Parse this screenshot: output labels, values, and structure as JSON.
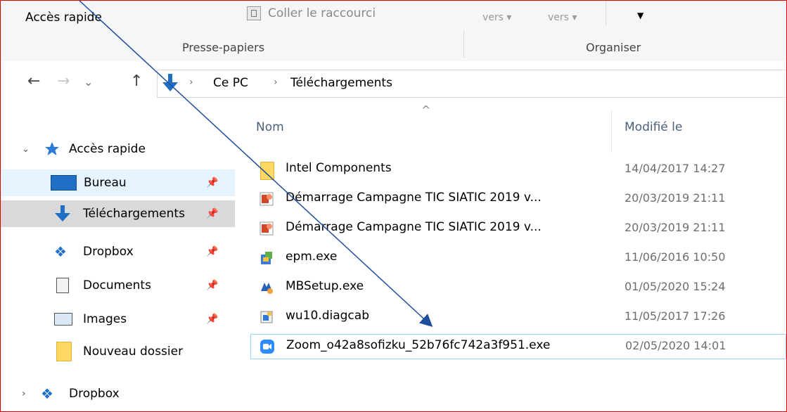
{
  "ribbon": {
    "quick_access": "Accès rapide",
    "paste_shortcut": "Coller le raccourci",
    "move_to": "vers ▾",
    "copy_to": "vers ▾",
    "clipboard_group": "Presse-papiers",
    "organize_group": "Organiser"
  },
  "address": {
    "back": "←",
    "forward": "→",
    "recent": "⌄",
    "up": "↑",
    "sep1": "›",
    "crumb1": "Ce PC",
    "sep2": "›",
    "crumb2": "Téléchargements"
  },
  "nav": {
    "quick_access": "Accès rapide",
    "items": [
      {
        "label": "Bureau"
      },
      {
        "label": "Téléchargements"
      },
      {
        "label": "Dropbox"
      },
      {
        "label": "Documents"
      },
      {
        "label": "Images"
      },
      {
        "label": "Nouveau dossier"
      }
    ],
    "dropbox_root": "Dropbox"
  },
  "columns": {
    "name": "Nom",
    "modified": "Modifié le"
  },
  "files": [
    {
      "name": "Intel Components",
      "date": "14/04/2017 14:27",
      "icon": "folder-icon"
    },
    {
      "name": "Démarrage Campagne TIC SIATIC 2019 v...",
      "date": "20/03/2019 21:11",
      "icon": "powerpoint-icon"
    },
    {
      "name": "Démarrage Campagne TIC SIATIC 2019 v...",
      "date": "20/03/2019 21:11",
      "icon": "powerpoint-icon"
    },
    {
      "name": "epm.exe",
      "date": "11/06/2016 10:50",
      "icon": "installer-icon"
    },
    {
      "name": "MBSetup.exe",
      "date": "01/05/2020 15:24",
      "icon": "setup-icon"
    },
    {
      "name": "wu10.diagcab",
      "date": "11/05/2017 17:26",
      "icon": "diagcab-icon"
    },
    {
      "name": "Zoom_o42a8sofizku_52b76fc742a3f951.exe",
      "date": "02/05/2020 14:01",
      "icon": "zoom-icon"
    }
  ],
  "colors": {
    "accent_blue": "#1f6fc4",
    "selection_border": "#99d1ff",
    "frame_red": "#d40000"
  }
}
